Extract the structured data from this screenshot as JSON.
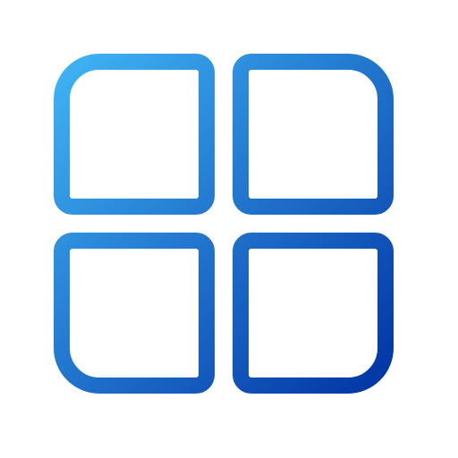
{
  "icon": {
    "semantic": "grid-icon",
    "gradient": {
      "start": "#41B6F6",
      "end": "#0032A3"
    },
    "background": "#ffffff"
  }
}
